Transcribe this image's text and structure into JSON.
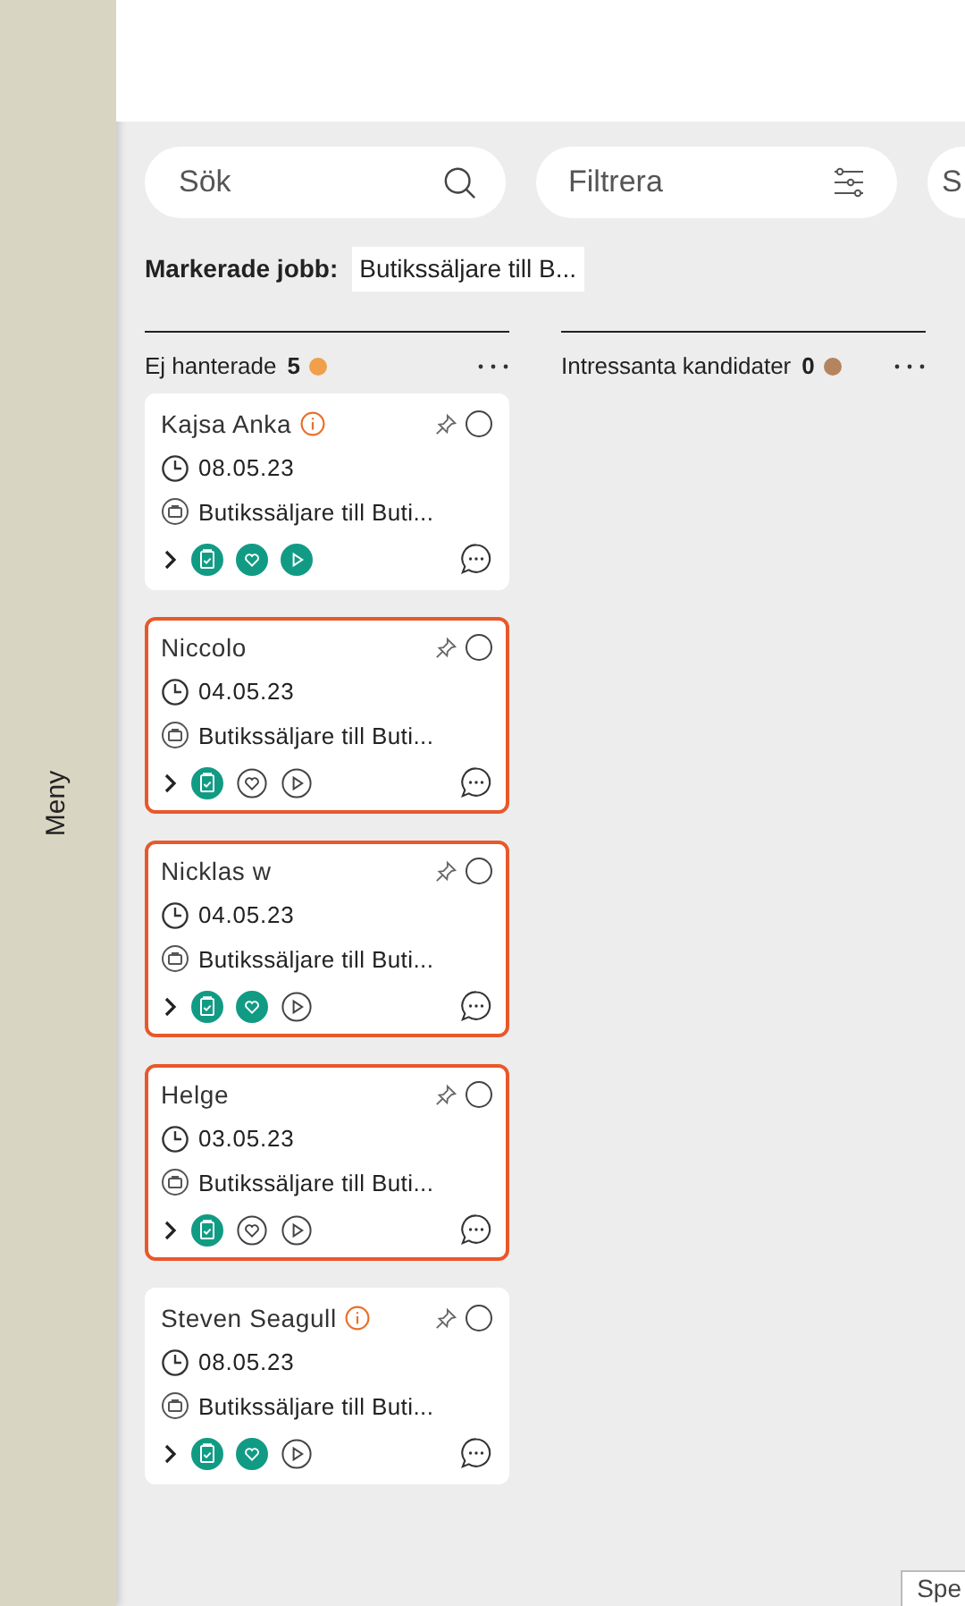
{
  "sidebar": {
    "label": "Meny"
  },
  "toolbar": {
    "search": {
      "placeholder": "Sök"
    },
    "filter": {
      "placeholder": "Filtrera"
    },
    "third": {
      "label": "S"
    }
  },
  "selected_jobs": {
    "label": "Markerade jobb:",
    "value": "Butikssäljare till B..."
  },
  "columns": [
    {
      "title": "Ej hanterade",
      "count": "5",
      "color": "#f0a04b",
      "cards": [
        {
          "name": "Kajsa Anka",
          "info": true,
          "highlighted": false,
          "date": "08.05.23",
          "job": "Butikssäljare till Buti...",
          "clipboard": true,
          "heart": true,
          "play": true
        },
        {
          "name": "Niccolo",
          "info": false,
          "highlighted": true,
          "date": "04.05.23",
          "job": "Butikssäljare till Buti...",
          "clipboard": true,
          "heart": false,
          "play": false
        },
        {
          "name": "Nicklas w",
          "info": false,
          "highlighted": true,
          "date": "04.05.23",
          "job": "Butikssäljare till Buti...",
          "clipboard": true,
          "heart": true,
          "play": false
        },
        {
          "name": "Helge",
          "info": false,
          "highlighted": true,
          "date": "03.05.23",
          "job": "Butikssäljare till Buti...",
          "clipboard": true,
          "heart": false,
          "play": false
        },
        {
          "name": "Steven Seagull",
          "info": true,
          "highlighted": false,
          "date": "08.05.23",
          "job": "Butikssäljare till Buti...",
          "clipboard": true,
          "heart": true,
          "play": false
        }
      ]
    },
    {
      "title": "Intressanta kandidater",
      "count": "0",
      "color": "#b5845c"
    }
  ],
  "footer_box": {
    "label": "Spe"
  }
}
